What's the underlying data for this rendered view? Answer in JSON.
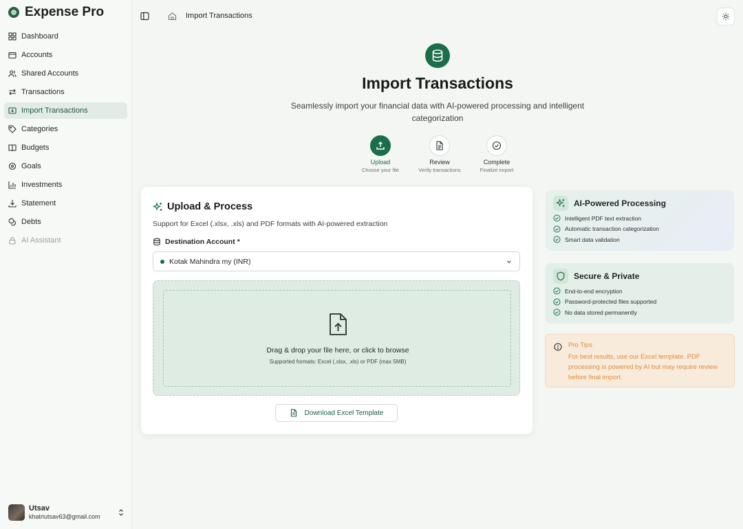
{
  "app": {
    "name": "Expense Pro"
  },
  "sidebar": {
    "items": [
      {
        "label": "Dashboard",
        "icon": "dashboard-icon"
      },
      {
        "label": "Accounts",
        "icon": "wallet-icon"
      },
      {
        "label": "Shared Accounts",
        "icon": "users-icon"
      },
      {
        "label": "Transactions",
        "icon": "arrows-swap-icon"
      },
      {
        "label": "Import Transactions",
        "icon": "import-icon",
        "active": true
      },
      {
        "label": "Categories",
        "icon": "tag-icon"
      },
      {
        "label": "Budgets",
        "icon": "book-icon"
      },
      {
        "label": "Goals",
        "icon": "target-icon"
      },
      {
        "label": "Investments",
        "icon": "bar-chart-icon"
      },
      {
        "label": "Statement",
        "icon": "download-icon"
      },
      {
        "label": "Debts",
        "icon": "coins-icon"
      },
      {
        "label": "AI Assistant",
        "icon": "lock-icon",
        "disabled": true
      }
    ]
  },
  "user": {
    "name": "Utsav",
    "email": "khatriutsav63@gmail.com"
  },
  "header": {
    "breadcrumb": "Import Transactions"
  },
  "hero": {
    "title": "Import Transactions",
    "subtitle": "Seamlessly import your financial data with AI-powered processing and intelligent categorization"
  },
  "steps": [
    {
      "label": "Upload",
      "desc": "Choose your file",
      "active": true
    },
    {
      "label": "Review",
      "desc": "Verify transactions"
    },
    {
      "label": "Complete",
      "desc": "Finalize import"
    }
  ],
  "upload": {
    "title": "Upload & Process",
    "subtitle": "Support for Excel (.xlsx, .xls) and PDF formats with AI-powered extraction",
    "dest_label": "Destination Account *",
    "selected_account": "Kotak Mahindra my (INR)",
    "drop_main": "Drag & drop your file here, or click to browse",
    "drop_sub": "Supported formats: Excel (.xlsx, .xls) or PDF (max 5MB)",
    "download_label": "Download Excel Template"
  },
  "ai_panel": {
    "title": "AI-Powered Processing",
    "items": [
      "Intelligent PDF text extraction",
      "Automatic transaction categorization",
      "Smart data validation"
    ]
  },
  "secure_panel": {
    "title": "Secure & Private",
    "items": [
      "End-to-end encryption",
      "Password-protected files supported",
      "No data stored permanently"
    ]
  },
  "tips": {
    "title": "Pro Tips",
    "body": "For best results, use our Excel template. PDF processing is powered by AI but may require review before final import."
  },
  "colors": {
    "accent": "#1a6e49",
    "tips": "#e08a3a"
  }
}
